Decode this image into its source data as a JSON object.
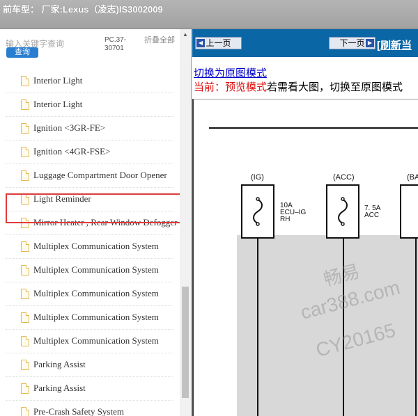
{
  "header": {
    "title": "前车型： 厂家:Lexus（凌志)IS3002009"
  },
  "search": {
    "placeholder": "输入关键字查询",
    "button_label": "查询",
    "pc_code": "PC.37-30701",
    "collapse_label": "折叠全部"
  },
  "tree": {
    "items": [
      {
        "label": "Interior Light"
      },
      {
        "label": "Interior Light"
      },
      {
        "label": "Ignition <3GR-FE>"
      },
      {
        "label": "Ignition <4GR-FSE>"
      },
      {
        "label": "Luggage Compartment Door Opener",
        "selected": true
      },
      {
        "label": "Light Reminder"
      },
      {
        "label": "Mirror Heater , Rear Window Defogger"
      },
      {
        "label": "Multiplex Communication System"
      },
      {
        "label": "Multiplex Communication System"
      },
      {
        "label": "Multiplex Communication System"
      },
      {
        "label": "Multiplex Communication System"
      },
      {
        "label": "Multiplex Communication System"
      },
      {
        "label": "Parking Assist"
      },
      {
        "label": "Parking Assist"
      },
      {
        "label": "Pre-Crash Safety System"
      }
    ]
  },
  "nav": {
    "prev_label": "上一页",
    "next_label": "下一页",
    "refresh_label": "[刷新当"
  },
  "mode": {
    "switch_link": "切换为原图模式",
    "current_label": "当前：预览模式",
    "hint": "若需看大图，切换至原图模式"
  },
  "diagram": {
    "fuses": [
      {
        "header": "(IG)",
        "rating": "10A",
        "name": "ECU–IG",
        "sub": "RH"
      },
      {
        "header": "(ACC)",
        "rating": "7. 5A",
        "name": "ACC",
        "sub": ""
      },
      {
        "header": "(BA",
        "rating": "",
        "name": "",
        "sub": ""
      }
    ],
    "watermark": {
      "line1": "畅易",
      "line2": "car388.com",
      "line3": "CY20165"
    }
  },
  "colors": {
    "nav_bar": "#0b66a6",
    "highlight": "#e03b3b",
    "search_button": "#2a7ed0",
    "mode_current": "#e01010"
  }
}
